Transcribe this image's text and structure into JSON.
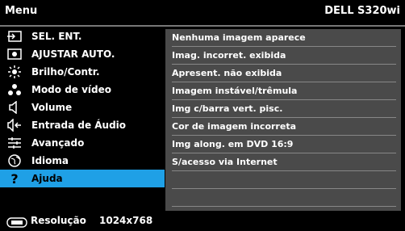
{
  "header": {
    "title": "Menu",
    "model": "DELL S320wi"
  },
  "menu": {
    "items": [
      {
        "label": "SEL. ENT.",
        "icon": "input-icon"
      },
      {
        "label": "AJUSTAR AUTO.",
        "icon": "auto-adjust-icon"
      },
      {
        "label": "Brilho/Contr.",
        "icon": "brightness-icon"
      },
      {
        "label": "Modo de vídeo",
        "icon": "video-mode-icon"
      },
      {
        "label": "Volume",
        "icon": "speaker-icon"
      },
      {
        "label": "Entrada de Áudio",
        "icon": "audio-input-icon"
      },
      {
        "label": "Avançado",
        "icon": "sliders-icon"
      },
      {
        "label": "Idioma",
        "icon": "globe-icon"
      },
      {
        "label": "Ajuda",
        "icon": "help-icon"
      }
    ],
    "selected_index": 8
  },
  "submenu": {
    "items": [
      "Nenhuma imagem aparece",
      "Imag. incorret. exibida",
      "Apresent. não exibida",
      "Imagem instável/trêmula",
      "Img c/barra vert. pisc.",
      "Cor de imagem incorreta",
      "Img along. em DVD 16:9",
      "S/acesso via Internet",
      "",
      ""
    ]
  },
  "footer": {
    "resolution_label": "Resolução",
    "resolution_value": "1024x768",
    "icon": "display-icon"
  },
  "colors": {
    "selected_bg": "#1fa0e6",
    "submenu_bg": "#4a4a4a",
    "background": "#000000"
  }
}
